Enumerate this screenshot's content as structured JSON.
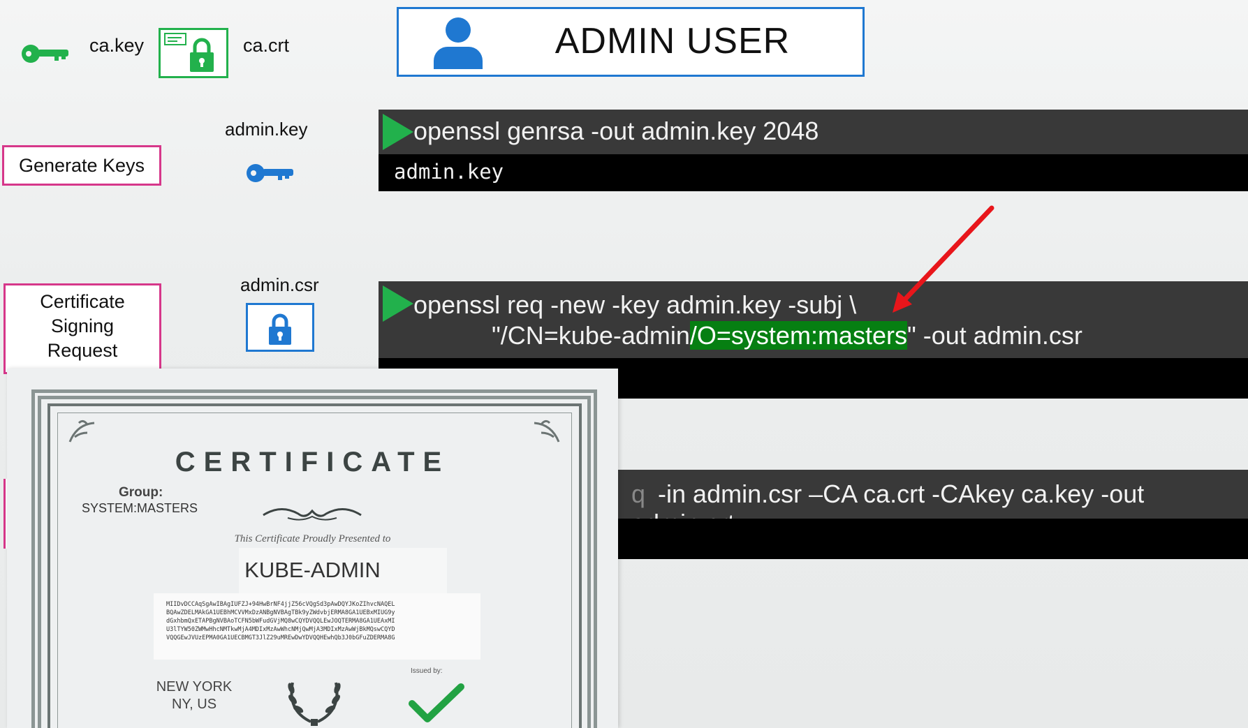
{
  "ca": {
    "key_label": "ca.key",
    "crt_label": "ca.crt"
  },
  "header": {
    "title": "ADMIN USER"
  },
  "steps": {
    "generate_keys": "Generate Keys",
    "csr_line1": "Certificate",
    "csr_line2": "Signing",
    "csr_line3": "Request"
  },
  "files": {
    "admin_key": "admin.key",
    "admin_csr": "admin.csr"
  },
  "terminal1": {
    "command": "openssl genrsa -out admin.key 2048",
    "output": "admin.key"
  },
  "terminal2": {
    "line1": "openssl req -new -key admin.key -subj  \\",
    "line2_prefix": "\"/CN=kube-admin",
    "line2_highlight": "/O=system:masters",
    "line2_suffix": "\" -out admin.csr"
  },
  "terminal3": {
    "partial_glyph": "q",
    "command": "-in admin.csr –CA ca.crt -CAkey ca.key -out admin.crt"
  },
  "certificate": {
    "title": "CERTIFICATE",
    "group_label": "Group:",
    "group_value": "SYSTEM:MASTERS",
    "presented": "This Certificate Proudly Presented to",
    "name": "KUBE-ADMIN",
    "code_lines": [
      "MIIDvDCCAqSgAwIBAgIUFZJ+94HwBrNF4jjZ56cVQgSd3pAwDQYJKoZIhvcNAQEL",
      "BQAwZDELMAkGA1UEBhMCVVMxDzANBgNVBAgTBk9yZWdvbjERMA8GA1UEBxMIUG9y",
      "dGxhbmQxETAPBgNVBAoTCFN5bWFudGVjMQ8wCQYDVQQLEwJOQTERMA8GA1UEAxMI",
      "U3lTYW50ZWMwHhcNMTkwMjA4MDIxMzAwWhcNMjQwMjA3MDIxMzAwWjBkMQswCQYD",
      "VQQGEwJVUzEPMA0GA1UECBMGT3JlZ29uMREwDwYDVQQHEwhQb3J0bGFuZDERMA8G"
    ],
    "location_line1": "NEW YORK",
    "location_line2": "NY, US",
    "issued_by": "Issued by:"
  },
  "colors": {
    "green": "#22b14c",
    "blue": "#1f78d1",
    "pink": "#d6378a",
    "highlight": "#067f12",
    "arrow": "#e8161b"
  },
  "icons": [
    "key-icon",
    "certificate-lock-icon",
    "person-icon",
    "lock-icon",
    "play-icon",
    "arrow-icon",
    "checkmark-icon",
    "laurel-icon"
  ]
}
